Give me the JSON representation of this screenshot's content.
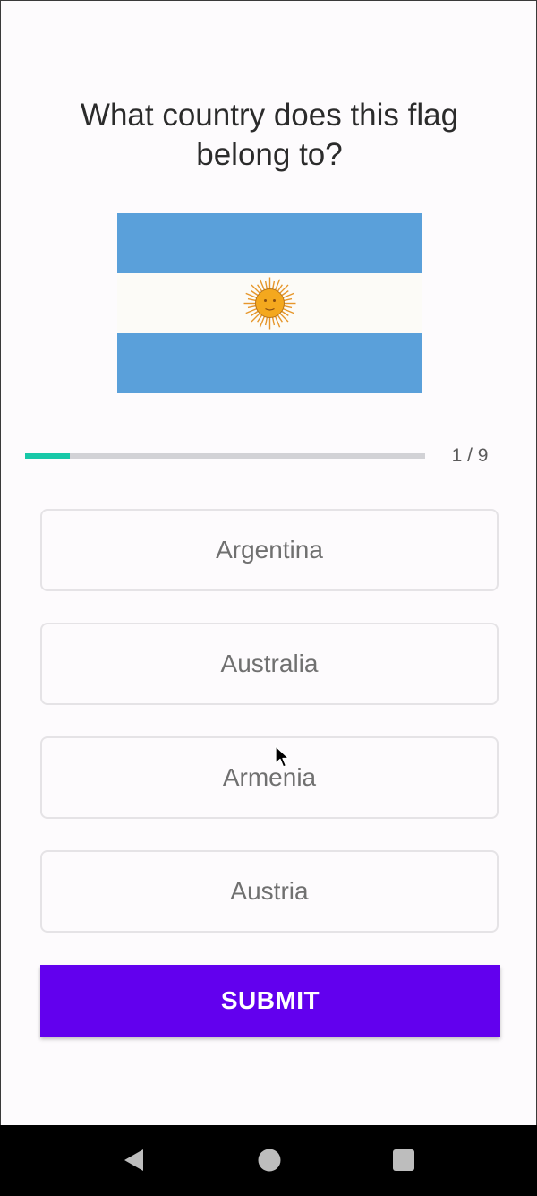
{
  "quiz": {
    "question": "What country does this flag belong to?",
    "flag_icon": "argentina-flag",
    "progress": {
      "current": 1,
      "total": 9,
      "label": "1 / 9"
    },
    "options": [
      {
        "label": "Argentina"
      },
      {
        "label": "Australia"
      },
      {
        "label": "Armenia"
      },
      {
        "label": "Austria"
      }
    ],
    "submit_label": "SUBMIT"
  },
  "colors": {
    "accent": "#6200ee",
    "progress_fill": "#18c8a8",
    "progress_track": "#d2d2d6",
    "flag_blue": "#5aa0da",
    "flag_white": "#fcfbf7",
    "flag_sun": "#f4a81e"
  },
  "navbar": {
    "back_icon": "back-triangle-icon",
    "home_icon": "home-circle-icon",
    "recents_icon": "recents-square-icon"
  }
}
